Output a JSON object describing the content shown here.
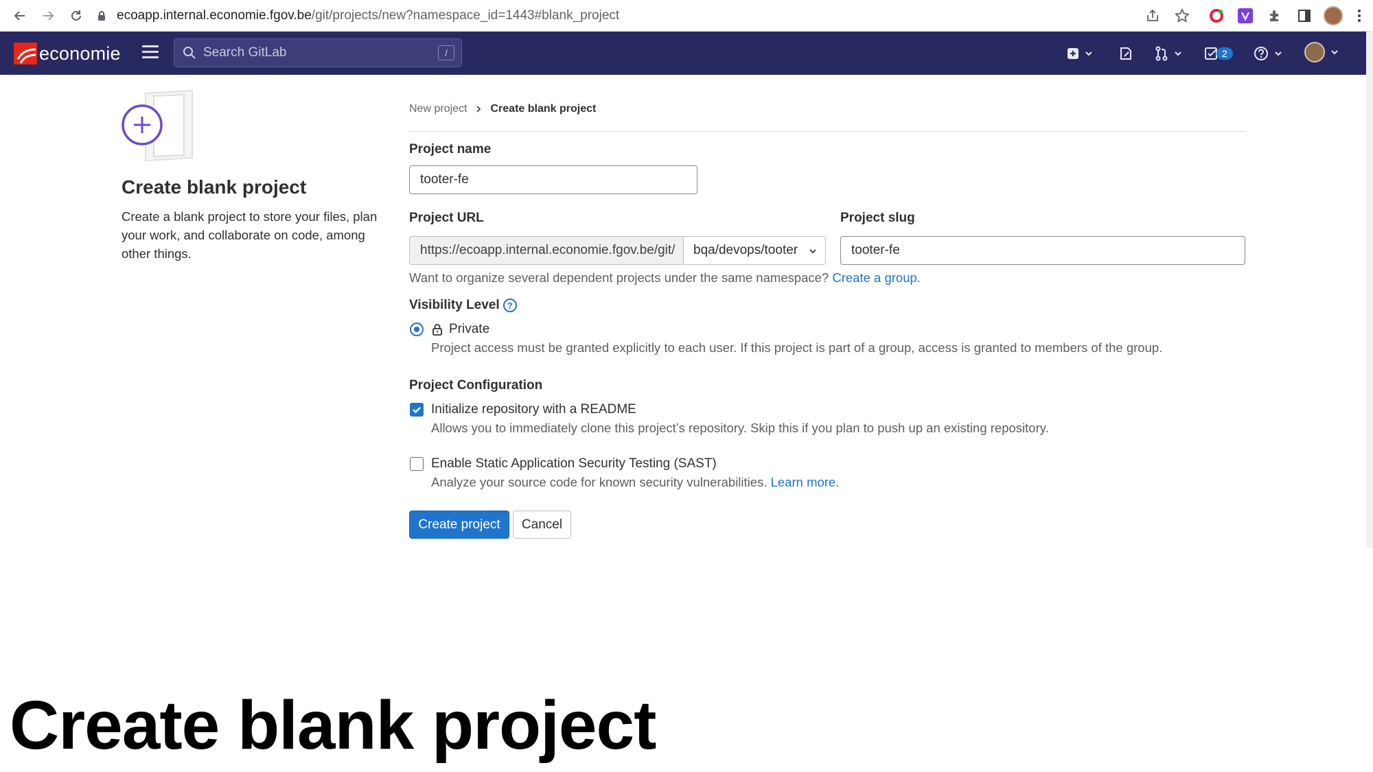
{
  "browser": {
    "url_host": "ecoapp.internal.economie.fgov.be",
    "url_path": "/git/projects/new?namespace_id=1443#blank_project"
  },
  "navbar": {
    "logo_text": "economie",
    "search_placeholder": "Search GitLab",
    "search_shortcut": "/",
    "todo_count": "2"
  },
  "left": {
    "title": "Create blank project",
    "description": "Create a blank project to store your files, plan your work, and collaborate on code, among other things."
  },
  "breadcrumb": {
    "parent": "New project",
    "current": "Create blank project"
  },
  "form": {
    "project_name_label": "Project name",
    "project_name_value": "tooter-fe",
    "project_url_label": "Project URL",
    "project_url_prefix": "https://ecoapp.internal.economie.fgov.be/git/",
    "namespace_value": "bqa/devops/tooter",
    "project_slug_label": "Project slug",
    "project_slug_value": "tooter-fe",
    "namespace_help": "Want to organize several dependent projects under the same namespace?",
    "namespace_help_link": "Create a group.",
    "visibility_label": "Visibility Level",
    "visibility_help_glyph": "?",
    "visibility_option": "Private",
    "visibility_help": "Project access must be granted explicitly to each user. If this project is part of a group, access is granted to members of the group.",
    "config_label": "Project Configuration",
    "readme_label": "Initialize repository with a README",
    "readme_help": "Allows you to immediately clone this project’s repository. Skip this if you plan to push up an existing repository.",
    "sast_label": "Enable Static Application Security Testing (SAST)",
    "sast_help": "Analyze your source code for known security vulnerabilities.",
    "sast_help_link": "Learn more.",
    "create_button": "Create project",
    "cancel_button": "Cancel"
  },
  "caption": "Create blank project",
  "colors": {
    "navbar": "#292961",
    "primary": "#1f75cb",
    "logo_red": "#e8261a"
  }
}
